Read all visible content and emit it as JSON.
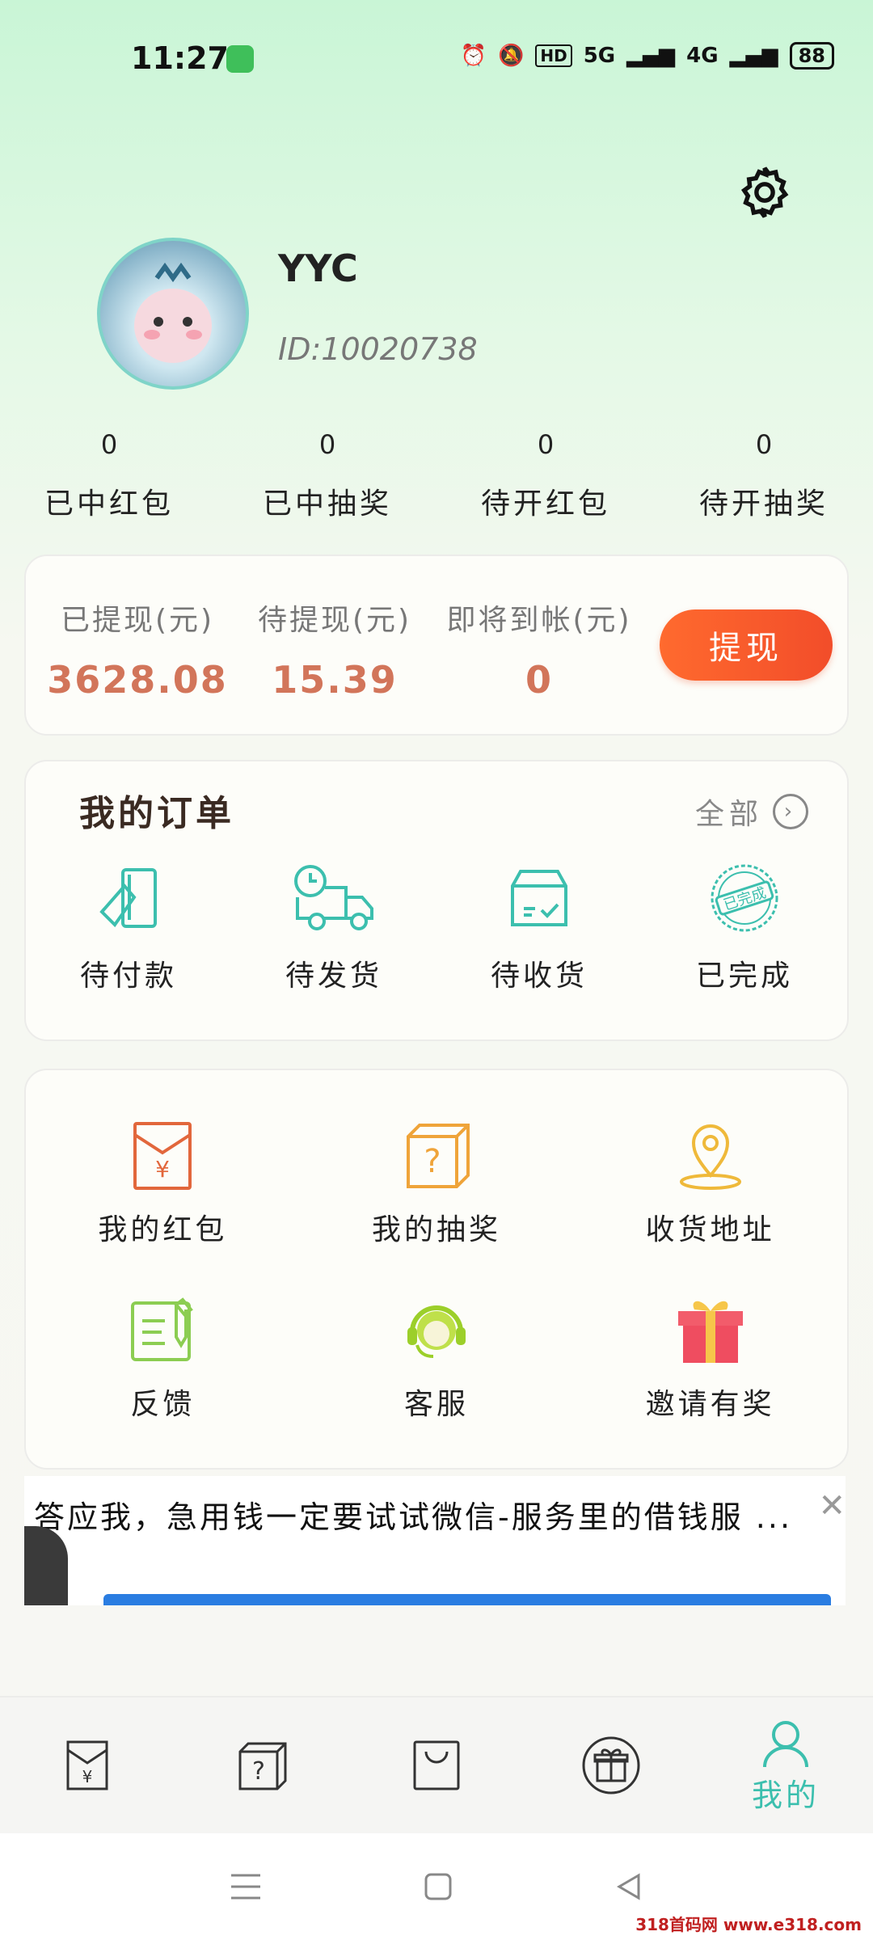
{
  "status": {
    "time": "11:27",
    "battery": "88",
    "hd": "HD",
    "net1": "5G",
    "net2": "4G"
  },
  "profile": {
    "name": "YYC",
    "id": "ID:10020738"
  },
  "stats": [
    {
      "value": "0",
      "label": "已中红包"
    },
    {
      "value": "0",
      "label": "已中抽奖"
    },
    {
      "value": "0",
      "label": "待开红包"
    },
    {
      "value": "0",
      "label": "待开抽奖"
    }
  ],
  "withdraw": {
    "items": [
      {
        "label": "已提现(元)",
        "value": "3628.08"
      },
      {
        "label": "待提现(元)",
        "value": "15.39"
      },
      {
        "label": "即将到帐(元)",
        "value": "0"
      }
    ],
    "button": "提现"
  },
  "orders": {
    "title": "我的订单",
    "all": "全部",
    "items": [
      {
        "label": "待付款",
        "icon": "payment-card-icon"
      },
      {
        "label": "待发货",
        "icon": "delivery-truck-icon"
      },
      {
        "label": "待收货",
        "icon": "package-box-icon"
      },
      {
        "label": "已完成",
        "icon": "completed-stamp-icon",
        "stamp": "已完成"
      }
    ]
  },
  "services": {
    "items": [
      {
        "label": "我的红包",
        "icon": "red-envelope-icon"
      },
      {
        "label": "我的抽奖",
        "icon": "mystery-box-icon"
      },
      {
        "label": "收货地址",
        "icon": "location-pin-icon"
      },
      {
        "label": "反馈",
        "icon": "feedback-note-icon"
      },
      {
        "label": "客服",
        "icon": "customer-service-icon"
      },
      {
        "label": "邀请有奖",
        "icon": "gift-box-icon"
      }
    ]
  },
  "ad": {
    "text": "答应我，急用钱一定要试试微信-服务里的借钱服 ..."
  },
  "tabs": [
    {
      "icon": "red-envelope-tab-icon",
      "label": ""
    },
    {
      "icon": "mystery-box-tab-icon",
      "label": ""
    },
    {
      "icon": "shopping-bag-tab-icon",
      "label": ""
    },
    {
      "icon": "gift-tab-icon",
      "label": ""
    },
    {
      "icon": "profile-tab-icon",
      "label": "我的",
      "active": true
    }
  ],
  "watermark": "318首码网 www.e318.com",
  "colors": {
    "accent": "#3cbfae",
    "withdraw_button": "#f4552b",
    "amount": "#d2755a",
    "envelope": "#e2673c",
    "pin": "#efb93a",
    "feedback": "#8ccd52",
    "gift": "#ef4d60"
  }
}
